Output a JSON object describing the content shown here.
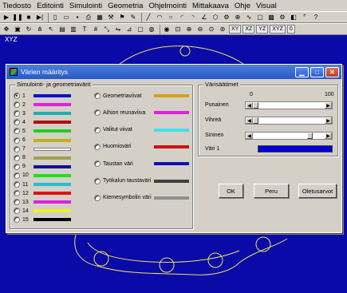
{
  "menu": [
    "Tiedosto",
    "Editointi",
    "Simulointi",
    "Geometria",
    "Ohjelmointi",
    "Mittakaava",
    "Ohje",
    "Visual"
  ],
  "toolbar": {
    "row1_help": "?",
    "row2_labels": [
      "XY",
      "XZ",
      "YZ",
      "XYZ",
      "0"
    ]
  },
  "canvas": {
    "label": "XYZ",
    "background": "#0a0aa8",
    "outline_color": "#f0e060"
  },
  "dialog": {
    "title": "Värien määritys",
    "left_group": {
      "label": "Simulointi- ja geometriavärit",
      "numbered": [
        {
          "n": "1",
          "color": "#1010c8",
          "selected": true
        },
        {
          "n": "2",
          "color": "#e020e0",
          "selected": false
        },
        {
          "n": "3",
          "color": "#20b0b0",
          "selected": false
        },
        {
          "n": "4",
          "color": "#b01010",
          "selected": false
        },
        {
          "n": "5",
          "color": "#20d020",
          "selected": false
        },
        {
          "n": "6",
          "color": "#c0b020",
          "selected": false
        },
        {
          "n": "7",
          "color": "#ffffff",
          "selected": false
        },
        {
          "n": "8",
          "color": "#a0a050",
          "selected": false
        },
        {
          "n": "9",
          "color": "#101090",
          "selected": false
        },
        {
          "n": "10",
          "color": "#20e020",
          "selected": false
        },
        {
          "n": "11",
          "color": "#20c0d0",
          "selected": false
        },
        {
          "n": "12",
          "color": "#e01010",
          "selected": false
        },
        {
          "n": "13",
          "color": "#e020e0",
          "selected": false
        },
        {
          "n": "14",
          "color": "#f0f020",
          "selected": false
        },
        {
          "n": "15",
          "color": "#000000",
          "selected": false
        }
      ],
      "named": [
        {
          "label": "Geometriaviivat",
          "color": "#d4a020"
        },
        {
          "label": "Aihion reunaviiva",
          "color": "#e020e0"
        },
        {
          "label": "Valitut viivat",
          "color": "#40e0f0"
        },
        {
          "label": "Huomioväri",
          "color": "#d01010"
        },
        {
          "label": "Taustan väri",
          "color": "#1010b0"
        },
        {
          "label": "Työkalun taustaväri",
          "color": "#404040"
        },
        {
          "label": "Kiemesymbolin väri",
          "color": "#909090"
        }
      ]
    },
    "right_group": {
      "label": "Värisäätimet",
      "scale_min": "0",
      "scale_max": "100",
      "sliders": [
        {
          "label": "Punainen",
          "value": 0
        },
        {
          "label": "Vihreä",
          "value": 0
        },
        {
          "label": "Sininen",
          "value": 80
        }
      ],
      "color1_label": "Väri 1",
      "color1_value": "#0000d0"
    },
    "buttons": {
      "ok": "OK",
      "cancel": "Peru",
      "defaults": "Oletusarvot"
    }
  }
}
